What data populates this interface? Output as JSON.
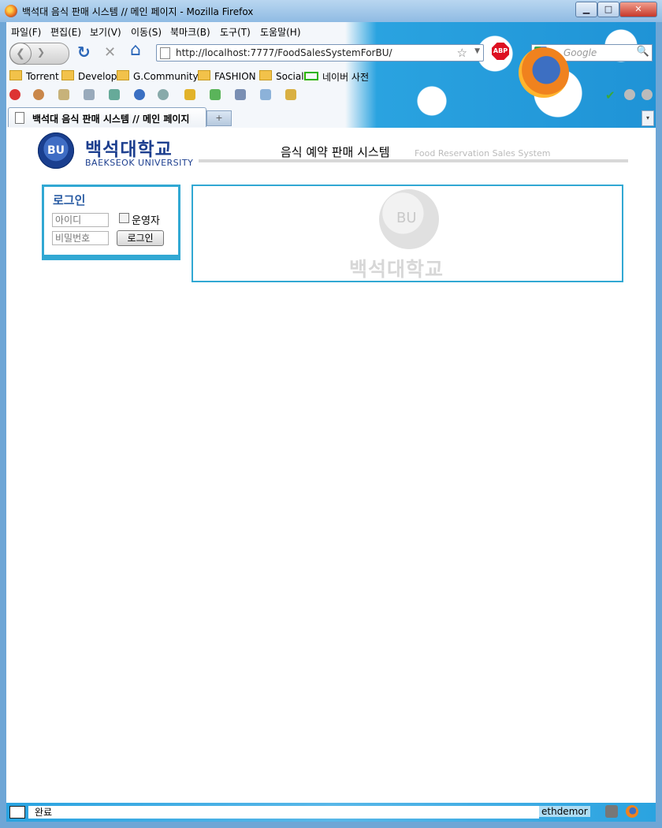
{
  "window": {
    "title": "백석대 음식 판매 시스템 // 메인 페이지 - Mozilla Firefox",
    "min_label": "▁",
    "max_label": "□",
    "close_label": "✕"
  },
  "menu": {
    "items": [
      "파일(F)",
      "편집(E)",
      "보기(V)",
      "이동(S)",
      "북마크(B)",
      "도구(T)",
      "도움말(H)"
    ]
  },
  "nav": {
    "back_glyph": "❮",
    "fwd_glyph": "❯",
    "reload_glyph": "↻",
    "stop_glyph": "✕",
    "home_glyph": "⌂",
    "url": "http://localhost:7777/FoodSalesSystemForBU/",
    "star_glyph": "☆",
    "abp_label": "ABP",
    "search_placeholder": "Google",
    "search_glyph": "🔍"
  },
  "bookmarks": {
    "items": [
      "Torrent",
      "Develop",
      "G.Community",
      "FASHION",
      "Social",
      "네이버 사전"
    ]
  },
  "tabs": {
    "active_title": "백석대 음식 판매 시스템 // 메인 페이지",
    "new_tab_glyph": "+",
    "list_glyph": "▾"
  },
  "site": {
    "logo_mark": "BU",
    "university_name": "백석대학교",
    "university_eng": "BAEKSEOK UNIVERSITY",
    "page_title": "음식 예약 판매 시스템",
    "page_subtitle": "Food Reservation Sales System"
  },
  "login": {
    "title": "로그인",
    "id_placeholder": "아이디",
    "pw_placeholder": "비밀번호",
    "operator_label": "운영자",
    "button_label": "로그인"
  },
  "watermark": {
    "mark": "BU",
    "text": "백석대학교"
  },
  "status": {
    "text": "완료",
    "user": "ethdemor"
  }
}
